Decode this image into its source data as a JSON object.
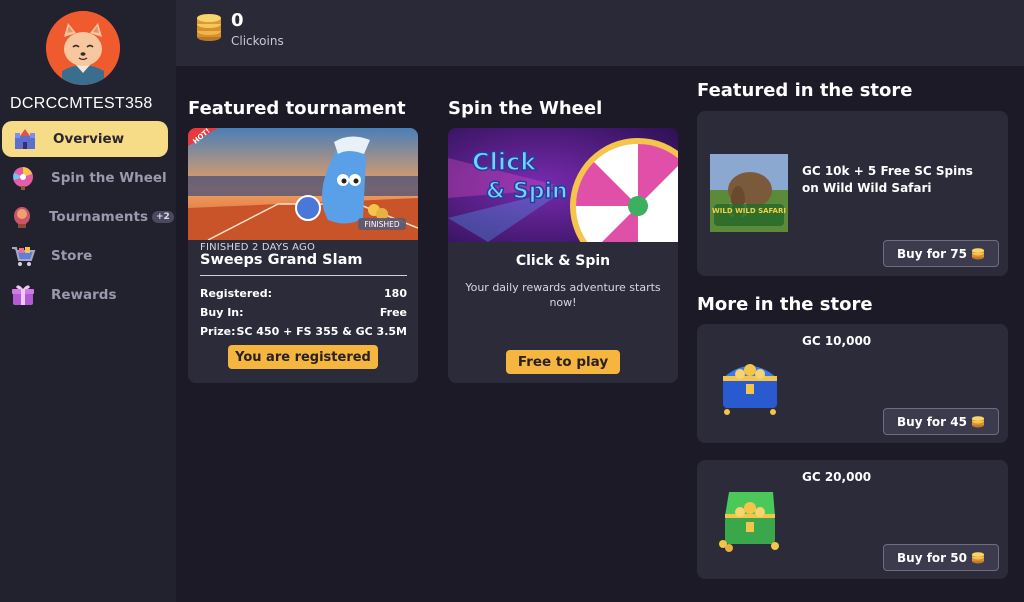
{
  "user": {
    "username": "DCRCCMTEST358"
  },
  "sidebar": {
    "items": [
      {
        "label": "Overview",
        "icon": "castle-icon",
        "active": true
      },
      {
        "label": "Spin the Wheel",
        "icon": "wheel-icon",
        "active": false
      },
      {
        "label": "Tournaments",
        "icon": "trophy-icon",
        "active": false,
        "badge": "+2"
      },
      {
        "label": "Store",
        "icon": "cart-icon",
        "active": false
      },
      {
        "label": "Rewards",
        "icon": "gift-icon",
        "active": false
      }
    ]
  },
  "topbar": {
    "clickoins_value": "0",
    "clickoins_label": "Clickoins"
  },
  "tournament": {
    "section_title": "Featured tournament",
    "hot_badge": "HOT!",
    "image_status": "FINISHED",
    "finished_text": "FINISHED 2 DAYS AGO",
    "name": "Sweeps Grand Slam",
    "rows": [
      {
        "label": "Registered:",
        "value": "180"
      },
      {
        "label": "Buy In:",
        "value": "Free"
      },
      {
        "label": "Prize:",
        "value": "SC 450 + FS 355 & GC 3.5M"
      }
    ],
    "button_label": "You are registered"
  },
  "spin": {
    "section_title": "Spin the Wheel",
    "image_text_line1": "Click",
    "image_text_line2": "& Spin",
    "title": "Click & Spin",
    "description": "Your daily rewards adventure starts now!",
    "button_label": "Free to play"
  },
  "store": {
    "featured_title": "Featured in the store",
    "featured_item": {
      "title": "GC 10k + 5 Free SC Spins on Wild Wild Safari",
      "game_name": "WILD WILD SAFARI",
      "buy_label": "Buy for 75"
    },
    "more_title": "More in the store",
    "more_items": [
      {
        "title": "GC 10,000",
        "buy_label": "Buy for 45"
      },
      {
        "title": "GC 20,000",
        "buy_label": "Buy for 50"
      }
    ]
  },
  "colors": {
    "accent_yellow": "#f5b63f",
    "active_nav": "#f6dc86",
    "card_bg": "#2c2b3a"
  }
}
